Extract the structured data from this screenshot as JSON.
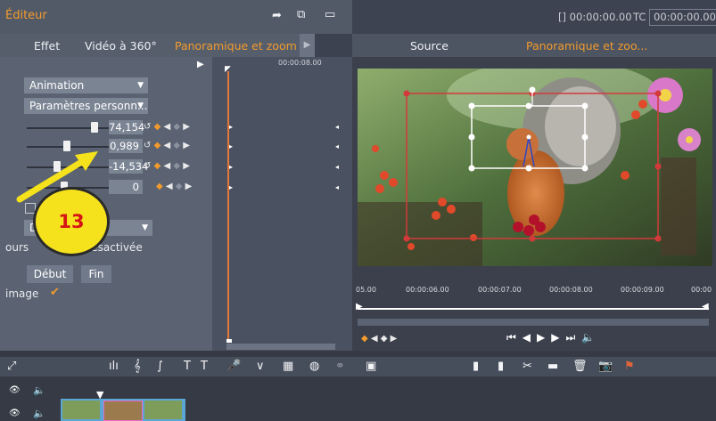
{
  "title": "Éditeur",
  "timecode": {
    "left": "[] 00:00:00.00",
    "tc_label": "TC",
    "tc_value": "00:00:00.00"
  },
  "tabs": [
    {
      "label": "Effet",
      "active": false
    },
    {
      "label": "Vidéo à 360°",
      "active": false
    },
    {
      "label": "Panoramique et zoom",
      "active": true
    }
  ],
  "source_tabs": [
    {
      "label": "Source",
      "active": false
    },
    {
      "label": "Panoramique et zoo...",
      "active": true
    }
  ],
  "left_panel": {
    "animation_label": "Animation",
    "preset_label": "Paramètres personn...",
    "sliders": [
      {
        "value": "74,154",
        "level": 0.85
      },
      {
        "value": "0,989",
        "level": 0.55
      },
      {
        "value": "-14,534",
        "level": 0.4
      },
      {
        "value": "0",
        "level": 0.5
      }
    ],
    "dropdown3_label": "D",
    "ours_label": "ours",
    "desactivee_label": "Désactivée",
    "debut_label": "Début",
    "fin_label": "Fin",
    "image_label": "image"
  },
  "keyframe_ruler": {
    "time": "00:00:08.00"
  },
  "callout": {
    "number": "13"
  },
  "ruler": [
    "05.00",
    "00:00:06.00",
    "00:00:07.00",
    "00:00:08.00",
    "00:00:09.00",
    "00:00"
  ],
  "accent": "#f29b2c"
}
